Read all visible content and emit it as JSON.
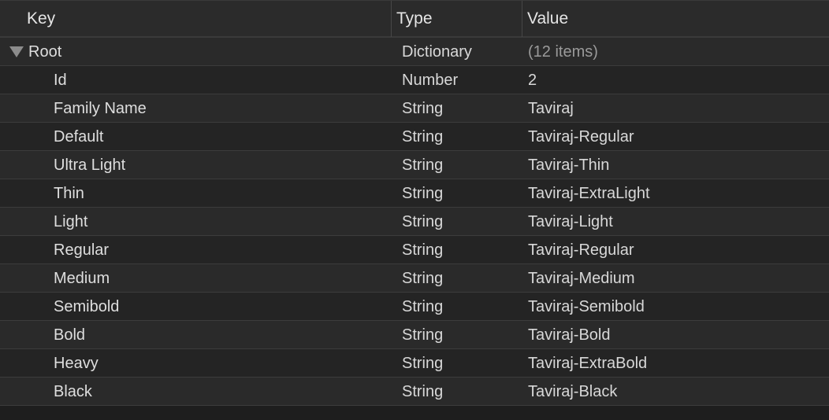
{
  "columns": {
    "key": "Key",
    "type": "Type",
    "value": "Value"
  },
  "root": {
    "key": "Root",
    "type": "Dictionary",
    "value": "(12 items)"
  },
  "items": [
    {
      "key": "Id",
      "type": "Number",
      "value": "2"
    },
    {
      "key": "Family Name",
      "type": "String",
      "value": "Taviraj"
    },
    {
      "key": "Default",
      "type": "String",
      "value": "Taviraj-Regular"
    },
    {
      "key": "Ultra Light",
      "type": "String",
      "value": "Taviraj-Thin"
    },
    {
      "key": "Thin",
      "type": "String",
      "value": "Taviraj-ExtraLight"
    },
    {
      "key": "Light",
      "type": "String",
      "value": "Taviraj-Light"
    },
    {
      "key": "Regular",
      "type": "String",
      "value": "Taviraj-Regular"
    },
    {
      "key": "Medium",
      "type": "String",
      "value": "Taviraj-Medium"
    },
    {
      "key": "Semibold",
      "type": "String",
      "value": "Taviraj-Semibold"
    },
    {
      "key": "Bold",
      "type": "String",
      "value": "Taviraj-Bold"
    },
    {
      "key": "Heavy",
      "type": "String",
      "value": "Taviraj-ExtraBold"
    },
    {
      "key": "Black",
      "type": "String",
      "value": "Taviraj-Black"
    }
  ]
}
